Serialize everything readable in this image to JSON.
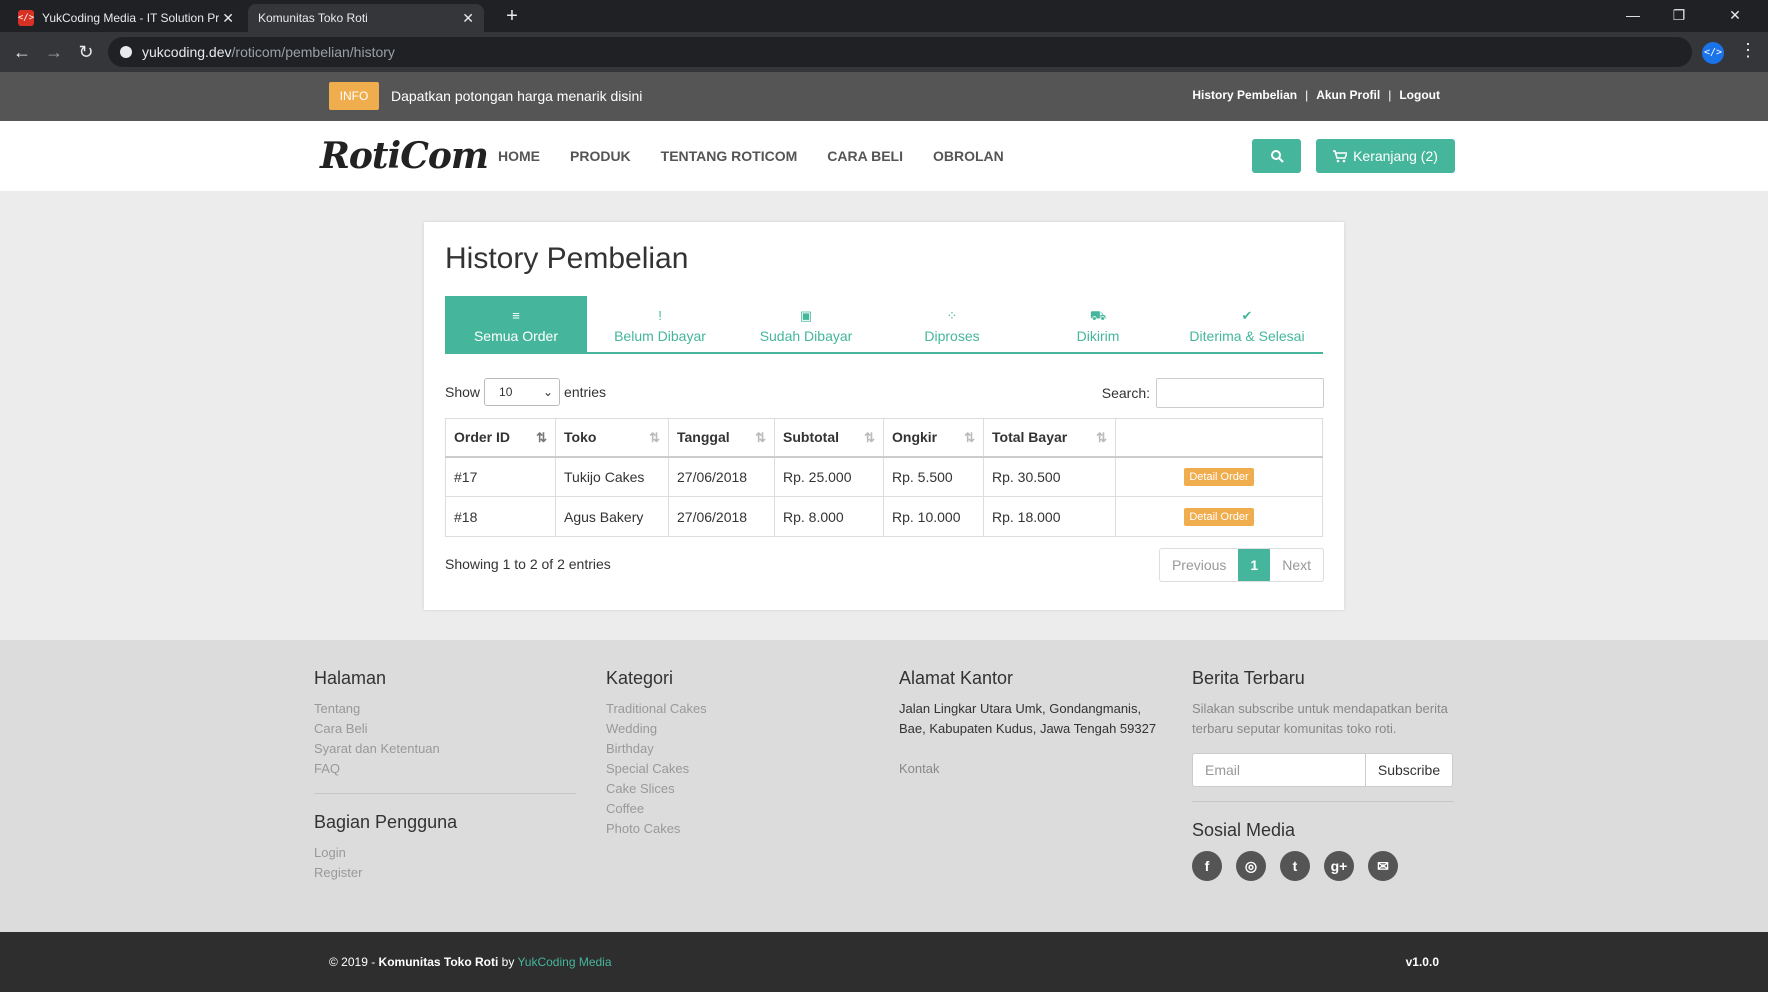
{
  "browser": {
    "tabs": [
      {
        "title": "YukCoding Media - IT Solution Pr",
        "close": "✕"
      },
      {
        "title": "Komunitas Toko Roti",
        "close": "✕"
      }
    ],
    "new_tab": "+",
    "url_host": "yukcoding.dev",
    "url_path": "/roticom/pembelian/history"
  },
  "infobar": {
    "badge": "INFO",
    "text": "Dapatkan potongan harga menarik disini",
    "links": [
      "History Pembelian",
      "Akun Profil",
      "Logout"
    ],
    "separator": "|"
  },
  "header": {
    "logo": "RotiCom",
    "nav": [
      "HOME",
      "PRODUK",
      "TENTANG ROTICOM",
      "CARA BELI",
      "OBROLAN"
    ],
    "cart_label": "Keranjang (2)"
  },
  "page": {
    "title": "History Pembelian",
    "tabs": [
      {
        "label": "Semua Order",
        "icon": "≡"
      },
      {
        "label": "Belum Dibayar",
        "icon": "!"
      },
      {
        "label": "Sudah Dibayar",
        "icon": "▣"
      },
      {
        "label": "Diproses",
        "icon": "⁘"
      },
      {
        "label": "Dikirim",
        "icon": "⛟"
      },
      {
        "label": "Diterima & Selesai",
        "icon": "✔"
      }
    ],
    "show_label": "Show",
    "show_value": "10",
    "entries_label": "entries",
    "search_label": "Search:",
    "columns": [
      "Order ID",
      "Toko",
      "Tanggal",
      "Subtotal",
      "Ongkir",
      "Total Bayar",
      ""
    ],
    "rows": [
      {
        "id": "#17",
        "toko": "Tukijo Cakes",
        "tanggal": "27/06/2018",
        "subtotal": "Rp. 25.000",
        "ongkir": "Rp. 5.500",
        "total": "Rp. 30.500",
        "action": "Detail Order"
      },
      {
        "id": "#18",
        "toko": "Agus Bakery",
        "tanggal": "27/06/2018",
        "subtotal": "Rp. 8.000",
        "ongkir": "Rp. 10.000",
        "total": "Rp. 18.000",
        "action": "Detail Order"
      }
    ],
    "info": "Showing 1 to 2 of 2 entries",
    "pager": {
      "prev": "Previous",
      "current": "1",
      "next": "Next"
    }
  },
  "footer": {
    "halaman": {
      "title": "Halaman",
      "items": [
        "Tentang",
        "Cara Beli",
        "Syarat dan Ketentuan",
        "FAQ"
      ]
    },
    "pengguna": {
      "title": "Bagian Pengguna",
      "items": [
        "Login",
        "Register"
      ]
    },
    "kategori": {
      "title": "Kategori",
      "items": [
        "Traditional Cakes",
        "Wedding",
        "Birthday",
        "Special Cakes",
        "Cake Slices",
        "Coffee",
        "Photo Cakes"
      ]
    },
    "alamat": {
      "title": "Alamat Kantor",
      "text": "Jalan Lingkar Utara Umk, Gondangmanis, Bae, Kabupaten Kudus, Jawa Tengah 59327",
      "kontak": "Kontak"
    },
    "berita": {
      "title": "Berita Terbaru",
      "text": "Silakan subscribe untuk mendapatkan berita terbaru seputar komunitas toko roti.",
      "email_placeholder": "Email",
      "subscribe": "Subscribe"
    },
    "sosial": {
      "title": "Sosial Media",
      "icons": [
        "f",
        "◎",
        "t",
        "g+",
        "✉"
      ]
    }
  },
  "bottom": {
    "copyright_prefix": "© 2019 - ",
    "copyright_name": "Komunitas Toko Roti",
    "by": " by ",
    "brand": "YukCoding Media",
    "version": "v1.0.0"
  },
  "colors": {
    "accent": "#45b69c",
    "warning": "#f0ad4e"
  }
}
